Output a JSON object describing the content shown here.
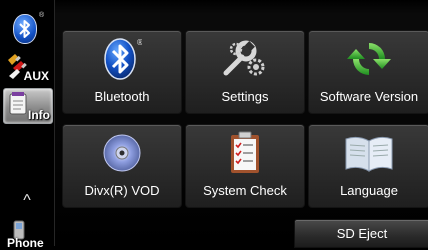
{
  "sidebar": {
    "aux_label": "AUX",
    "info_label": "Info",
    "up_arrow": "^",
    "phone_label": "Phone"
  },
  "tiles": [
    {
      "label": "Bluetooth",
      "icon": "bluetooth-icon"
    },
    {
      "label": "Settings",
      "icon": "settings-tools-icon"
    },
    {
      "label": "Software Version",
      "icon": "refresh-arrows-icon"
    },
    {
      "label": "Divx(R) VOD",
      "icon": "disc-icon"
    },
    {
      "label": "System Check",
      "icon": "checklist-clipboard-icon"
    },
    {
      "label": "Language",
      "icon": "open-book-icon"
    }
  ],
  "sd_eject_label": "SD Eject",
  "colors": {
    "background": "#000000",
    "tile": "#2d2d2d",
    "bluetooth_blue": "#1250c4",
    "refresh_green": "#3bbf2f",
    "text": "#ffffff"
  }
}
